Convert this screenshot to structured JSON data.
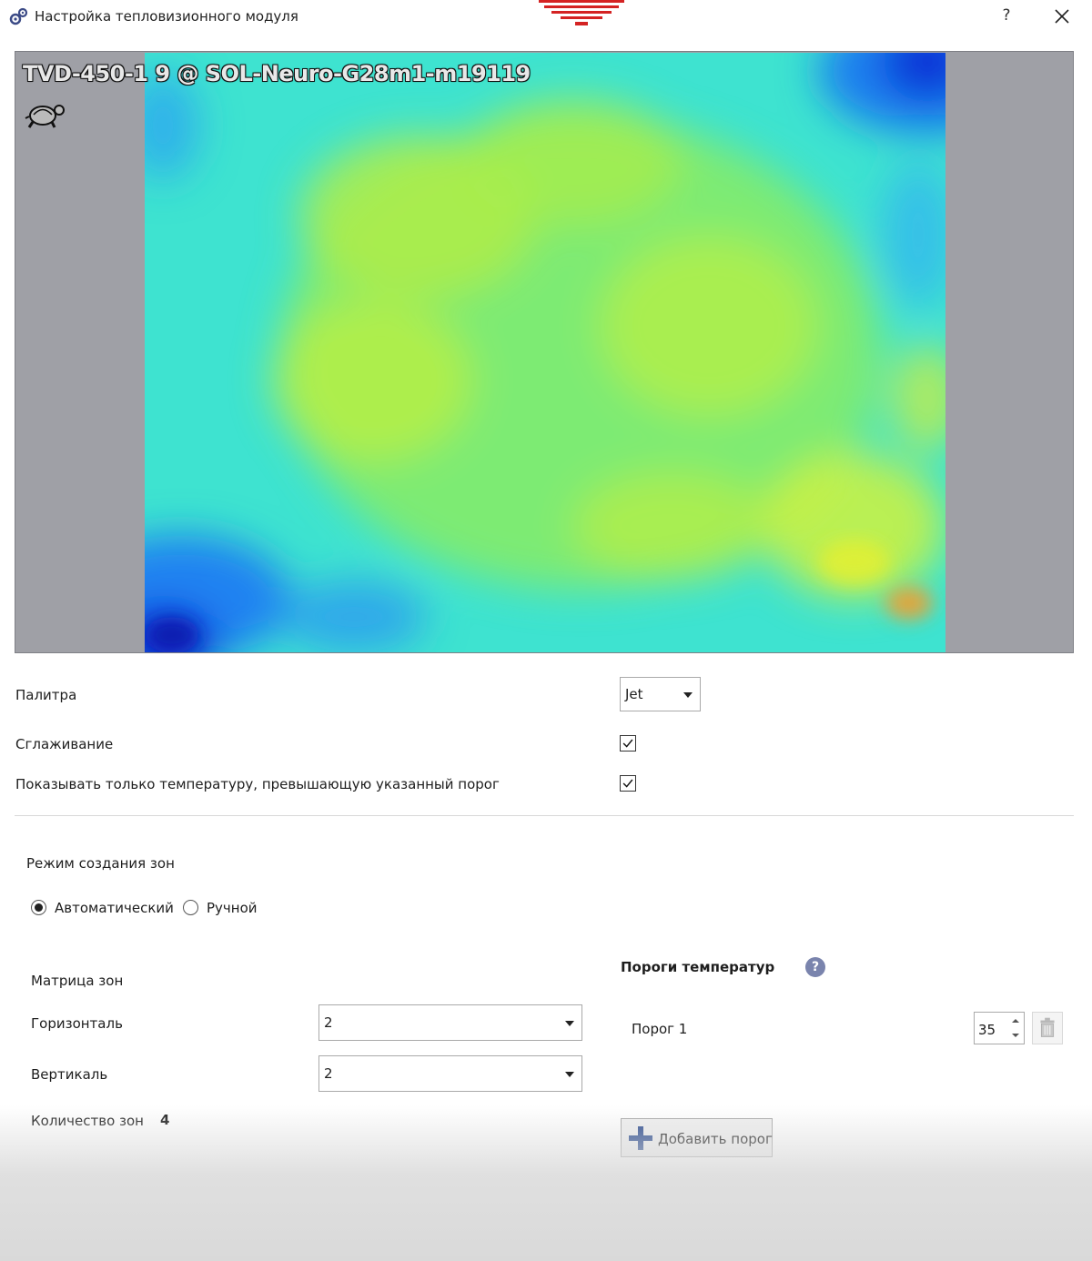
{
  "window": {
    "title": "Настройка тепловизионного модуля",
    "help_label": "?"
  },
  "preview": {
    "camera_label": "TVD-450-1 9 @ SOL-Neuro-G28m1-m19119",
    "status_icon": "turtle-icon"
  },
  "settings": {
    "palette_label": "Палитра",
    "palette_value": "Jet",
    "smoothing_label": "Сглаживание",
    "smoothing_checked": true,
    "threshold_only_label": "Показывать только температуру, превышающую указанный порог",
    "threshold_only_checked": true
  },
  "zone_mode": {
    "title": "Режим создания зон",
    "options": [
      {
        "label": "Автоматический",
        "selected": true
      },
      {
        "label": "Ручной",
        "selected": false
      }
    ]
  },
  "matrix": {
    "title": "Матрица зон",
    "horizontal_label": "Горизонталь",
    "horizontal_value": "2",
    "vertical_label": "Вертикаль",
    "vertical_value": "2",
    "count_label": "Количество зон",
    "count_value": "4"
  },
  "thresholds": {
    "title": "Пороги температур",
    "info_icon": "?",
    "items": [
      {
        "label": "Порог 1",
        "value": "35"
      }
    ],
    "add_label": "Добавить порог"
  },
  "colors": {
    "accent": "#d42323",
    "info": "#7a84ad",
    "add_plus": "#2a4a8e"
  }
}
